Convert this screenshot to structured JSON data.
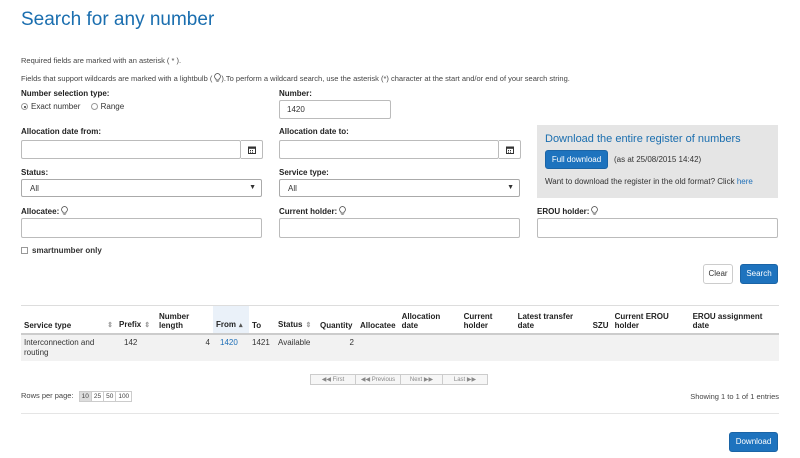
{
  "page": {
    "title": "Search for any number",
    "note1": "Required fields are marked with an asterisk ( * ).",
    "note2_pre": "Fields that support wildcards are marked with a lightbulb (",
    "note2_post": ").To perform a wildcard search, use the asterisk (*) character at the start and/or end of your search string."
  },
  "form": {
    "number_selection_label": "Number selection type:",
    "radio_exact": "Exact number",
    "radio_range": "Range",
    "number_label": "Number:",
    "number_value": "1420",
    "alloc_from_label": "Allocation date from:",
    "alloc_to_label": "Allocation date to:",
    "status_label": "Status:",
    "status_value": "All",
    "service_type_label": "Service type:",
    "service_type_value": "All",
    "allocatee_label": "Allocatee:",
    "current_holder_label": "Current holder:",
    "erou_holder_label": "EROU holder:",
    "smartnumber_label": "smartnumber only",
    "clear_label": "Clear",
    "search_label": "Search"
  },
  "download_panel": {
    "title": "Download the entire register of numbers",
    "full_download_label": "Full download",
    "as_at": "(as at 25/08/2015 14:42)",
    "old_format_text": "Want to download the register in the old format? Click",
    "here_link": "here"
  },
  "table": {
    "headers": {
      "service_type": "Service type",
      "prefix": "Prefix",
      "number_length": "Number length",
      "from": "From",
      "to": "To",
      "status": "Status",
      "quantity": "Quantity",
      "allocatee": "Allocatee",
      "allocation_date": "Allocation date",
      "current_holder": "Current holder",
      "latest_transfer_date": "Latest transfer date",
      "szu": "SZU",
      "current_erou_holder": "Current EROU holder",
      "erou_assignment_date": "EROU assignment date"
    },
    "rows": [
      {
        "service_type": "Interconnection and routing",
        "prefix": "142",
        "number_length": "4",
        "from": "1420",
        "to": "1421",
        "status": "Available",
        "quantity": "2",
        "allocatee": "",
        "allocation_date": "",
        "current_holder": "",
        "latest_transfer_date": "",
        "szu": "",
        "current_erou_holder": "",
        "erou_assignment_date": ""
      }
    ]
  },
  "pagination": {
    "first": "First",
    "previous": "Previous",
    "next": "Next",
    "last": "Last",
    "rows_per_page_label": "Rows per page:",
    "rows_options": [
      "10",
      "25",
      "50",
      "100"
    ],
    "selected_rows": "10",
    "showing": "Showing 1 to 1 of 1 entries"
  },
  "footer": {
    "download_label": "Download"
  },
  "icons": [
    "lightbulb-icon",
    "calendar-icon",
    "caret-down-icon",
    "sort-icon",
    "first-icon",
    "previous-icon",
    "next-icon",
    "last-icon"
  ],
  "colors": {
    "accent": "#1e73be",
    "title": "#1a6eaf",
    "panel_bg": "#e5e5e5",
    "row_bg": "#f2f2f2"
  }
}
